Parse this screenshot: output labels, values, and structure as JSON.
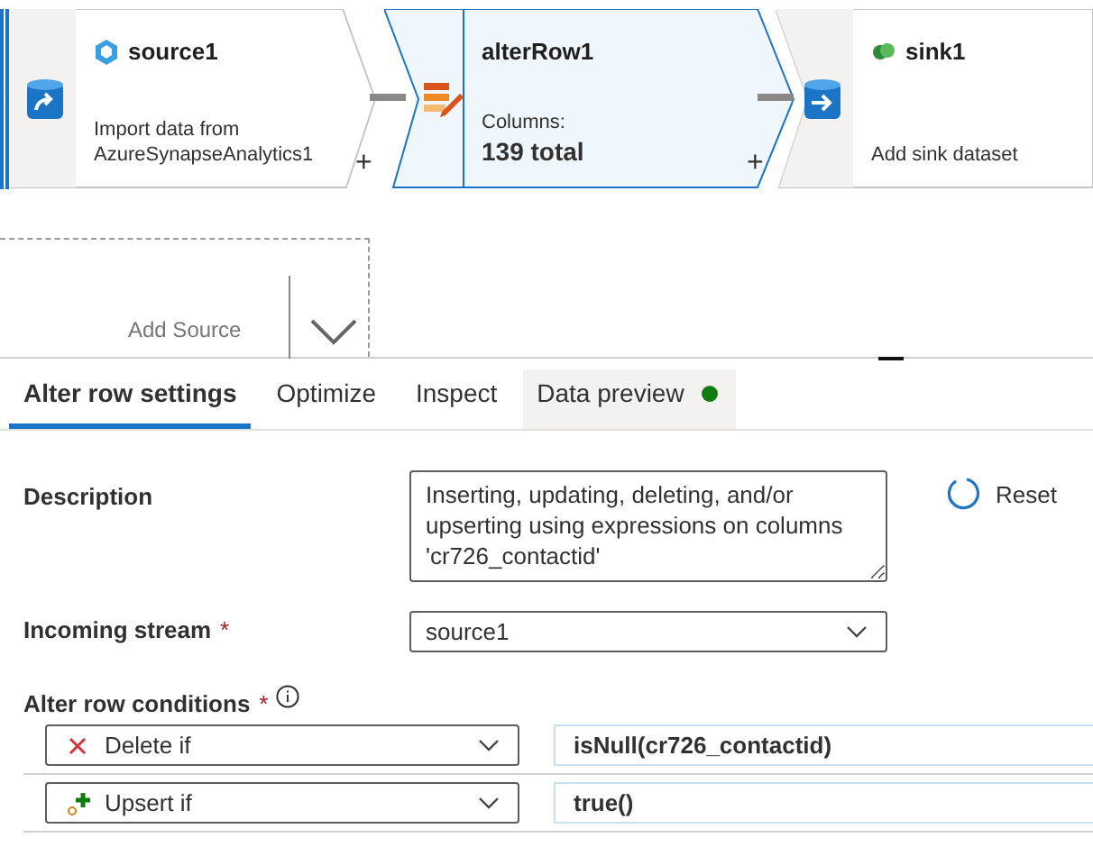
{
  "nodes": [
    {
      "kind": "source",
      "title": "source1",
      "subtitle": "Import data from",
      "detail": "AzureSynapseAnalytics1",
      "selected": false
    },
    {
      "kind": "alterrow",
      "title": "alterRow1",
      "subtitle": "Columns:",
      "detail": "139 total",
      "selected": true
    },
    {
      "kind": "sink",
      "title": "sink1",
      "subtitle": "Add sink dataset",
      "selected": false
    }
  ],
  "add_buttons": [
    "+",
    "+"
  ],
  "add_source": {
    "label": "Add Source"
  },
  "tabs": [
    {
      "label": "Alter row settings",
      "selected": true
    },
    {
      "label": "Optimize",
      "selected": false
    },
    {
      "label": "Inspect",
      "selected": false
    },
    {
      "label": "Data preview",
      "selected": false,
      "color": "#107c10"
    }
  ],
  "description": {
    "label": "Description",
    "value": "Inserting, updating, deleting, and/or upserting using expressions on columns 'cr726_contactid'"
  },
  "reset_button": {
    "label": "Reset"
  },
  "incoming_stream": {
    "label": "Incoming stream",
    "required_mark": "*",
    "value": "source1"
  },
  "conditions": {
    "label": "Alter row conditions",
    "required_mark": "*",
    "rows": [
      {
        "kind": "delete",
        "action": "Delete if",
        "expression": "isNull(cr726_contactid)"
      },
      {
        "kind": "upsert",
        "action": "Upsert if",
        "expression": "true()"
      }
    ]
  }
}
